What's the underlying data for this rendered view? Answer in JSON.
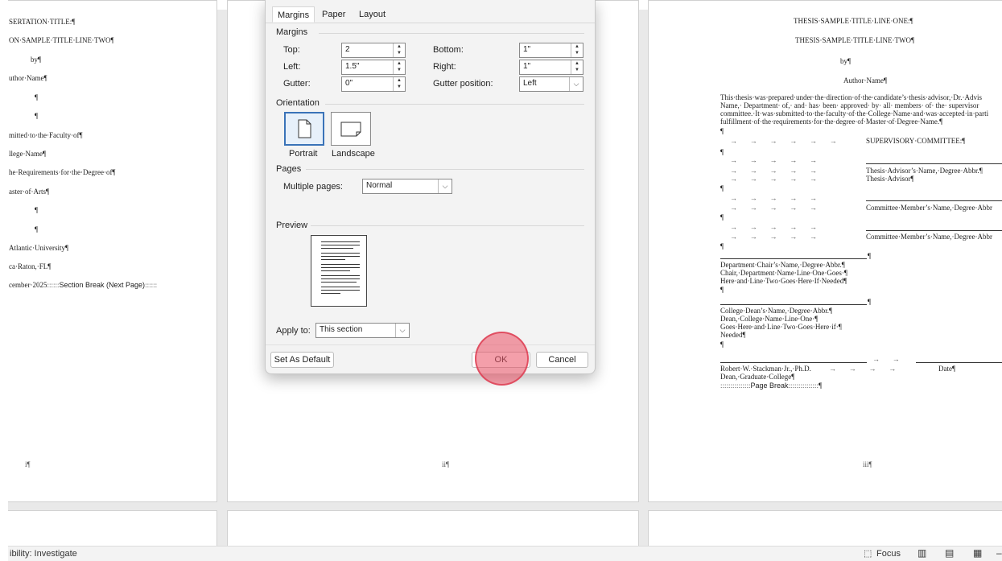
{
  "page1": {
    "lines": [
      "SERTATION·TITLE:¶",
      "ON·SAMPLE·TITLE·LINE·TWO¶",
      "by¶",
      "uthor·Name¶",
      "¶",
      "¶",
      "mitted·to·the·Faculty·of¶",
      "llege·Name¶",
      "he·Requirements·for·the·Degree·of¶",
      "aster·of·Arts¶",
      "¶",
      "¶",
      "Atlantic·University¶",
      "ca·Raton,·FL¶",
      "cember·2025",
      "Section Break (Next Page)"
    ],
    "page_number": "i¶"
  },
  "page2": {
    "page_number": "ii¶"
  },
  "page3": {
    "title1": "THESIS·SAMPLE·TITLE·LINE·ONE:¶",
    "title2": "THESIS·SAMPLE·TITLE·LINE·TWO¶",
    "by": "by¶",
    "author": "Author·Name¶",
    "para": [
      "This·thesis·was·prepared·under·the·direction·of·the·candidate’s·thesis·advisor,·Dr.·Advis",
      "Name,· Department· of,· and· has· been· approved· by· all· members· of· the· supervisor",
      "committee.·It·was·submitted·to·the·faculty·of·the·College·Name·and·was·accepted·in·parti",
      "fulfillment·of·the·requirements·for·the·degree·of·Master·of·Degree·Name.¶"
    ],
    "pilcrow": "¶",
    "committee_heading": "SUPERVISORY·COMMITTEE:¶",
    "advisor_name": "Thesis·Advisor’s·Name,·Degree·Abbr.¶",
    "advisor_role": "Thesis·Advisor¶",
    "member1": "Committee·Member’s·Name,·Degree·Abbr",
    "member2": "Committee·Member’s·Name,·Degree·Abbr",
    "chair": [
      "Department·Chair’s·Name,·Degree·Abbr.¶",
      "Chair,·Department·Name·Line·One·Goes·¶",
      "Here·and·Line·Two·Goes·Here·If·Needed¶"
    ],
    "dean": [
      "College·Dean’s·Name,·Degree·Abbr.¶",
      "Dean,·College·Name·Line·One·¶",
      "Goes·Here·and·Line·Two·Goes·Here·if·¶",
      "Needed¶"
    ],
    "signer": "Robert·W.·Stackman·Jr.,·Ph.D.",
    "date": "Date¶",
    "signer_title": "Dean,·Graduate·College¶",
    "page_break": "Page Break",
    "page_number": "iii¶"
  },
  "dialog": {
    "tabs": [
      "Margins",
      "Paper",
      "Layout"
    ],
    "margins_group": "Margins",
    "top_label": "Top:",
    "top_value": "2",
    "bottom_label": "Bottom:",
    "bottom_value": "1\"",
    "left_label": "Left:",
    "left_value": "1.5\"",
    "right_label": "Right:",
    "right_value": "1\"",
    "gutter_label": "Gutter:",
    "gutter_value": "0\"",
    "gutter_pos_label": "Gutter position:",
    "gutter_pos_value": "Left",
    "orientation_group": "Orientation",
    "portrait": "Portrait",
    "landscape": "Landscape",
    "pages_group": "Pages",
    "multiple_pages_label": "Multiple pages:",
    "multiple_pages_value": "Normal",
    "preview_group": "Preview",
    "apply_to_label": "Apply to:",
    "apply_to_value": "This section",
    "set_default": "Set As Default",
    "ok": "OK",
    "cancel": "Cancel"
  },
  "statusbar": {
    "accessibility": "ibility: Investigate",
    "focus": "Focus"
  }
}
